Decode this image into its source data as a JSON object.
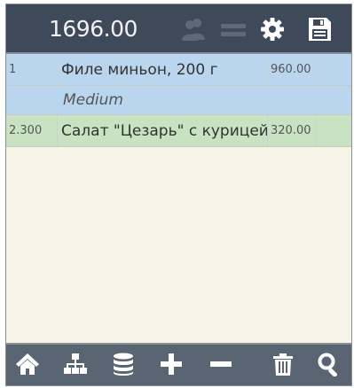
{
  "header": {
    "total": "1696.00"
  },
  "order": {
    "items": [
      {
        "qty": "1",
        "name": "Филе миньон, 200 г",
        "price": "960.00",
        "modifier": "Medium"
      },
      {
        "qty": "2.300",
        "name": "Салат \"Цезарь\" с курицей",
        "price": "320.00"
      }
    ]
  },
  "colors": {
    "topbar": "#3e4a5a",
    "bottombar": "#5a6574",
    "row_selected": "#bad6ee",
    "row_sent": "#c9e3c2",
    "background": "#f7f3e6"
  },
  "icons": {
    "top": [
      "guests-icon",
      "menu-lines-icon",
      "settings-gear-icon",
      "save-floppy-icon"
    ],
    "bottom": [
      "home-icon",
      "hierarchy-icon",
      "database-icon",
      "plus-icon",
      "minus-icon",
      "trash-icon",
      "search-icon"
    ]
  }
}
